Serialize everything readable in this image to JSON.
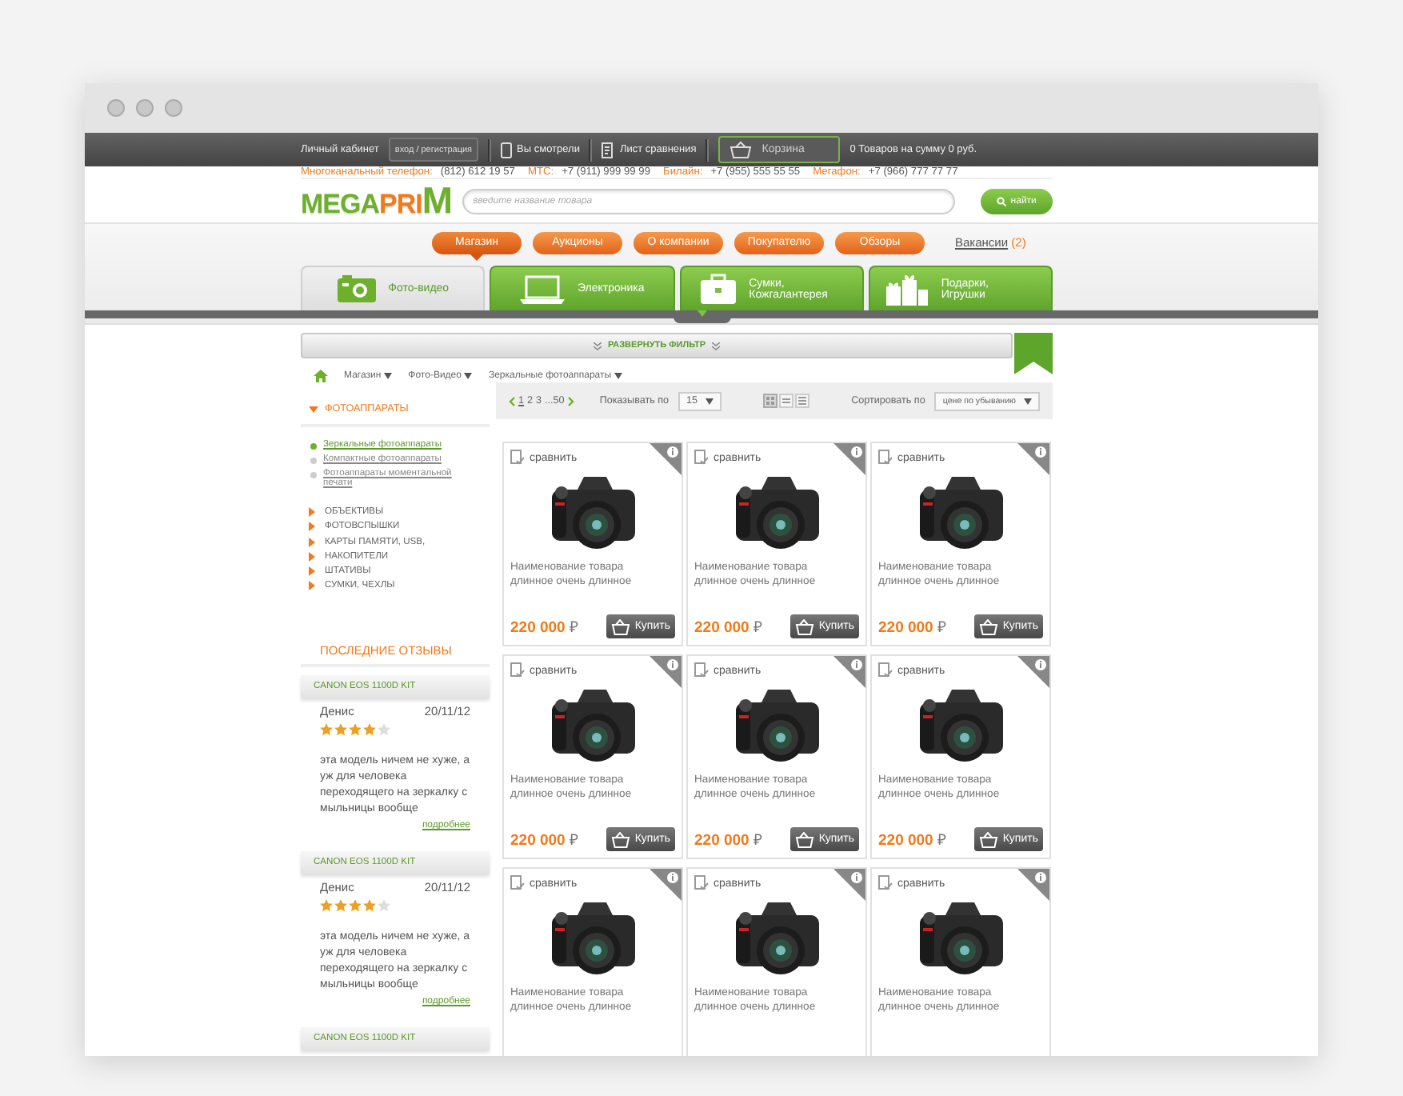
{
  "top_bar": {
    "account_label": "Личный кабинет",
    "login_button": "вход / регистрация",
    "viewed_link": "Вы смотрели",
    "compare_link": "Лист сравнения",
    "cart_button": "Корзина",
    "cart_summary": "0 Товаров на сумму 0 руб."
  },
  "phones": [
    {
      "label": "Многоканальный телефон:",
      "number": "(812) 612 19 57"
    },
    {
      "label": "МТС:",
      "number": "+7 (911) 999 99 99"
    },
    {
      "label": "Билайн:",
      "number": "+7 (955) 555 55 55"
    },
    {
      "label": "Мегафон:",
      "number": "+7 (966) 777 77 77"
    }
  ],
  "logo": [
    {
      "text": "MEGA",
      "color": "#6cb02c"
    },
    {
      "text": "PRI",
      "color": "#f07a1c"
    },
    {
      "text": "M",
      "color": "#6cb02c"
    }
  ],
  "search": {
    "placeholder": "введите название товара",
    "button": "найти"
  },
  "nav": [
    {
      "label": "Магазин",
      "selected": true
    },
    {
      "label": "Аукционы",
      "selected": false
    },
    {
      "label": "О компании",
      "selected": false
    },
    {
      "label": "Покупателю",
      "selected": false
    },
    {
      "label": "Обзоры",
      "selected": false
    }
  ],
  "vacancies": {
    "label": "Вакансии",
    "count": "(2)"
  },
  "categories": [
    {
      "label": "Фото-видео",
      "kind": "camera",
      "selected": true
    },
    {
      "label": "Электроника",
      "kind": "laptop",
      "selected": false
    },
    {
      "label": "Сумки, Кожгалантерея",
      "kind": "bag",
      "selected": false
    },
    {
      "label": "Подарки, Игрушки",
      "kind": "gift",
      "selected": false
    }
  ],
  "filter_toggle": "РАЗВЕРНУТЬ ФИЛЬТР",
  "breadcrumbs": [
    "Магазин",
    "Фото-Видео",
    "Зеркальные фотоаппараты"
  ],
  "sidebar": {
    "heading": "ФОТОАППАРАТЫ",
    "subcategories": [
      {
        "label": "Зеркальные фотоаппараты",
        "selected": true
      },
      {
        "label": "Компактные фотоаппараты",
        "selected": false
      },
      {
        "label": "Фотоаппараты моментальной печати",
        "selected": false
      }
    ],
    "categories": [
      "ОБЪЕКТИВЫ",
      "ФОТОВСПЫШКИ",
      "КАРТЫ ПАМЯТИ, USB,",
      "НАКОПИТЕЛИ",
      "ШТАТИВЫ",
      "СУМКИ, ЧЕХЛЫ"
    ],
    "reviews_heading": "ПОСЛЕДНИЕ ОТЗЫВЫ",
    "reviews": [
      {
        "product": "CANON EOS 1100D KIT",
        "author": "Денис",
        "date": "20/11/12",
        "stars": 4,
        "text": "эта модель ничем не хуже, а уж для человека переходящего на зеркалку с мыльницы вообще",
        "more": "подробнее"
      },
      {
        "product": "CANON EOS 1100D KIT",
        "author": "Денис",
        "date": "20/11/12",
        "stars": 4,
        "text": "эта модель ничем не хуже, а уж для человека переходящего на зеркалку с мыльницы вообще",
        "more": "подробнее"
      },
      {
        "product": "CANON EOS 1100D KIT"
      }
    ]
  },
  "toolbar": {
    "pages": [
      {
        "label": "1",
        "selected": true
      },
      {
        "label": "2",
        "selected": false
      },
      {
        "label": "3",
        "selected": false
      },
      {
        "label": "...50",
        "selected": false
      }
    ],
    "per_page_label": "Показывать по",
    "per_page": "15",
    "views": [
      {
        "kind": "grid",
        "selected": true
      },
      {
        "kind": "list",
        "selected": false
      },
      {
        "kind": "table",
        "selected": false
      }
    ],
    "sort_label": "Сортировать по",
    "sort_value": "цене по убыванию"
  },
  "products": [
    {
      "compare": "сравнить",
      "name": "Наименование товара длинное очень длинное",
      "price": "220 000",
      "currency": "₽",
      "buy": "Купить"
    },
    {
      "compare": "сравнить",
      "name": "Наименование товара длинное очень длинное",
      "price": "220 000",
      "currency": "₽",
      "buy": "Купить"
    },
    {
      "compare": "сравнить",
      "name": "Наименование товара длинное очень длинное",
      "price": "220 000",
      "currency": "₽",
      "buy": "Купить"
    },
    {
      "compare": "сравнить",
      "name": "Наименование товара длинное очень длинное",
      "price": "220 000",
      "currency": "₽",
      "buy": "Купить"
    },
    {
      "compare": "сравнить",
      "name": "Наименование товара длинное очень длинное",
      "price": "220 000",
      "currency": "₽",
      "buy": "Купить"
    },
    {
      "compare": "сравнить",
      "name": "Наименование товара длинное очень длинное",
      "price": "220 000",
      "currency": "₽",
      "buy": "Купить"
    },
    {
      "compare": "сравнить",
      "name": "Наименование товара длинное очень длинное"
    },
    {
      "compare": "сравнить",
      "name": "Наименование товара длинное очень длинное"
    },
    {
      "compare": "сравнить",
      "name": "Наименование товара длинное очень длинное"
    }
  ]
}
